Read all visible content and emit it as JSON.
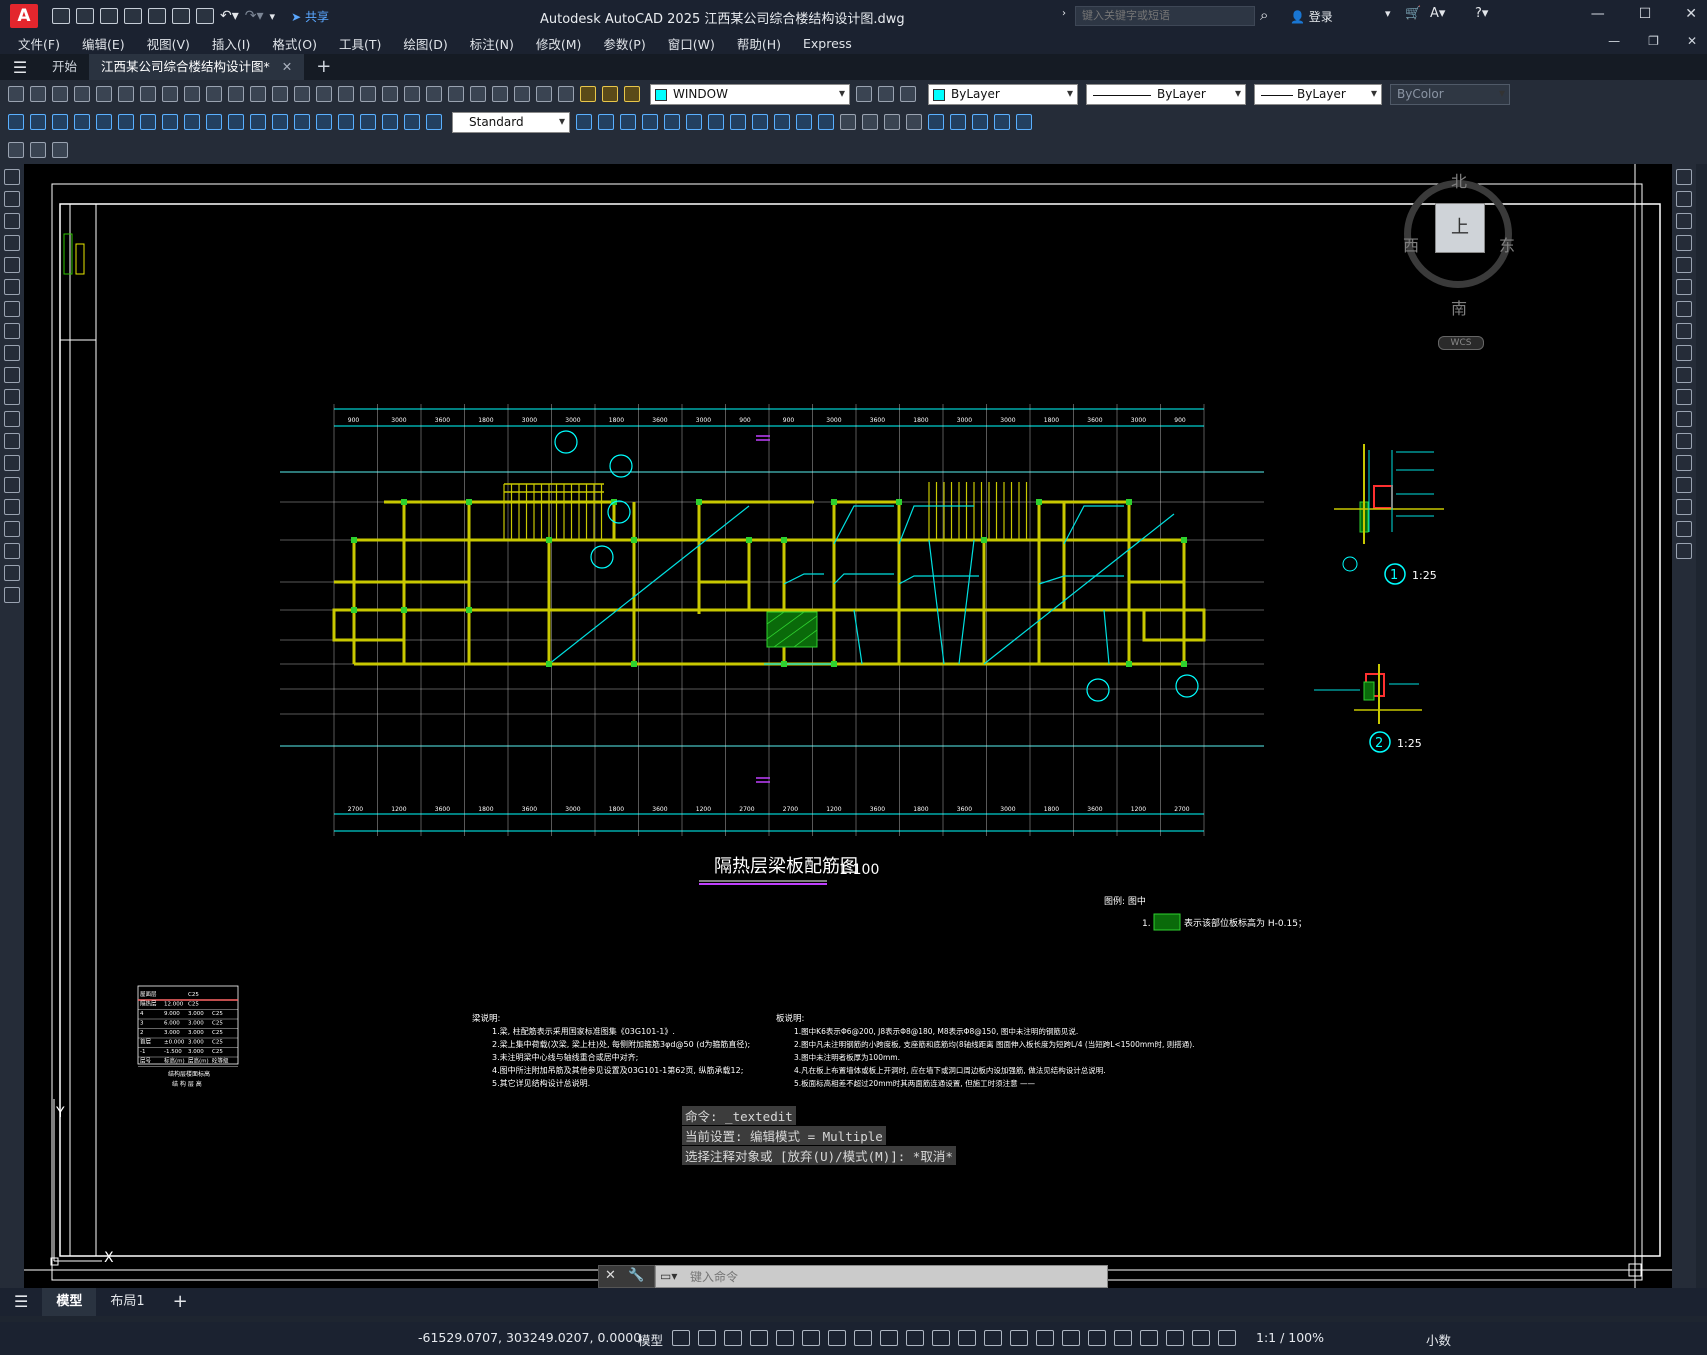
{
  "titlebar": {
    "logo": "A",
    "share_label": "共享",
    "app_title": "Autodesk AutoCAD 2025    江西某公司综合楼结构设计图.dwg",
    "search_placeholder": "键入关键字或短语",
    "login_label": "登录",
    "min": "—",
    "max": "☐",
    "close": "✕"
  },
  "menu": [
    "文件(F)",
    "编辑(E)",
    "视图(V)",
    "插入(I)",
    "格式(O)",
    "工具(T)",
    "绘图(D)",
    "标注(N)",
    "修改(M)",
    "参数(P)",
    "窗口(W)",
    "帮助(H)",
    "Express"
  ],
  "tabs": {
    "start": "开始",
    "active": "江西某公司综合楼结构设计图*",
    "close": "✕",
    "add": "+"
  },
  "toolbar": {
    "layer_value": "WINDOW",
    "color_value": "ByLayer",
    "linetype_value": "ByLayer",
    "lineweight_value": "ByLayer",
    "plotstyle_value": "ByColor",
    "textstyle_value": "Standard"
  },
  "viewcube": {
    "north": "北",
    "south": "南",
    "east": "东",
    "west": "西",
    "face": "上",
    "wcs": "WCS"
  },
  "drawing": {
    "main_title": "隔热层梁板配筋图",
    "main_scale": "1:100",
    "detail1_num": "1",
    "detail1_scale": "1:25",
    "detail2_num": "2",
    "detail2_scale": "1:25",
    "legend_title": "图例: 图中",
    "legend_item": "1.",
    "legend_text": "表示该部位板标高为 H-0.15；",
    "notes_left_title": "梁说明:",
    "notes_left": [
      "1.梁, 柱配筋表示采用国家标准图集《03G101-1》.",
      "2.梁上集中荷载(次梁, 梁上柱)处, 每侧附加箍筋3φd@50 (d为箍筋直径);",
      "3.未注明梁中心线与轴线重合或居中对齐;",
      "4.图中所注附加吊筋及其他参见设置及03G101-1第62页, 纵筋承载12;",
      "5.其它详见结构设计总说明."
    ],
    "notes_right_title": "板说明:",
    "notes_right": [
      "1.图中K6表示Φ6@200, J8表示Φ8@180, M8表示Φ8@150, 图中未注明的钢筋见说.",
      "2.图中凡未注明钢筋的小跨度板, 支座筋和底筋均(8轴线距离 图面伸入板长度为短跨L/4 (当短跨L<1500mm时, 则搭通).",
      "3.图中未注明者板厚为100mm.",
      "4.凡在板上布置墙体或板上开洞时, 应在墙下或洞口周边板内设加强筋, 做法见结构设计总说明.",
      "5.板面标高相差不超过20mm时其两面筋连通设置, 但施工时须注意 ——"
    ],
    "table_caption1": "结构层楼面标高",
    "table_caption2": "结 构 层 高",
    "table_rows": [
      [
        "屋面层",
        "",
        "C25"
      ],
      [
        "隔热层",
        "12.000",
        "C25"
      ],
      [
        "4",
        "9.000",
        "3.000",
        "C25"
      ],
      [
        "3",
        "6.000",
        "3.000",
        "C25"
      ],
      [
        "2",
        "3.000",
        "3.000",
        "C25"
      ],
      [
        "首层",
        "±0.000",
        "3.000",
        "C25"
      ],
      [
        "-1",
        "-1.500",
        "3.000",
        "C25"
      ],
      [
        "层号",
        "标高(m)",
        "层高(m)",
        "砼等级"
      ]
    ],
    "top_dims": [
      "900",
      "3000",
      "3600",
      "1800",
      "3000",
      "3000",
      "1800",
      "3600",
      "3000",
      "900",
      "900",
      "3000",
      "3600",
      "1800",
      "3000",
      "3000",
      "1800",
      "3600",
      "3000",
      "900"
    ],
    "bottom_dims": [
      "2700",
      "1200",
      "3600",
      "1800",
      "3600",
      "3000",
      "1800",
      "3600",
      "1200",
      "2700",
      "2700",
      "1200",
      "3600",
      "1800",
      "3600",
      "3000",
      "1800",
      "3600",
      "1200",
      "2700"
    ],
    "ucs_y": "Y",
    "ucs_x": "X"
  },
  "command": {
    "history": [
      "命令: _textedit",
      "当前设置: 编辑模式 = Multiple",
      "选择注释对象或 [放弃(U)/模式(M)]: *取消*"
    ],
    "input_placeholder": "键入命令"
  },
  "bottom_tabs": {
    "model": "模型",
    "layout1": "布局1",
    "add": "+"
  },
  "status": {
    "coords": "-61529.0707, 303249.0207, 0.0000",
    "mode": "模型",
    "scale": "1:1 / 100%",
    "units": "小数"
  }
}
